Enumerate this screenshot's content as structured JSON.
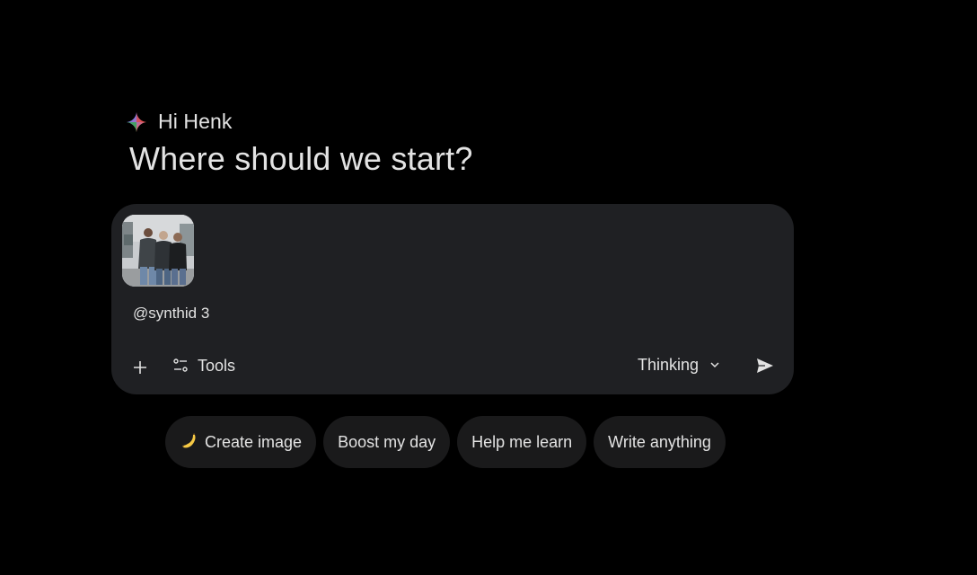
{
  "greeting": {
    "hi": "Hi Henk",
    "headline": "Where should we start?"
  },
  "composer": {
    "attachment_icon": "photo-thumbnail",
    "prompt": "@synthid 3",
    "tools_label": "Tools",
    "mode_label": "Thinking",
    "icons": {
      "plus": "plus-icon",
      "tools": "tools-sliders-icon",
      "mode": "chevron-down-icon",
      "send": "send-icon"
    }
  },
  "chips": [
    {
      "label": "Create image",
      "icon": "banana-icon"
    },
    {
      "label": "Boost my day"
    },
    {
      "label": "Help me learn"
    },
    {
      "label": "Write anything"
    }
  ],
  "colors": {
    "background": "#000000",
    "composer": "#1f2023",
    "chip": "#1a1a1b",
    "text": "#e3e3e3"
  }
}
